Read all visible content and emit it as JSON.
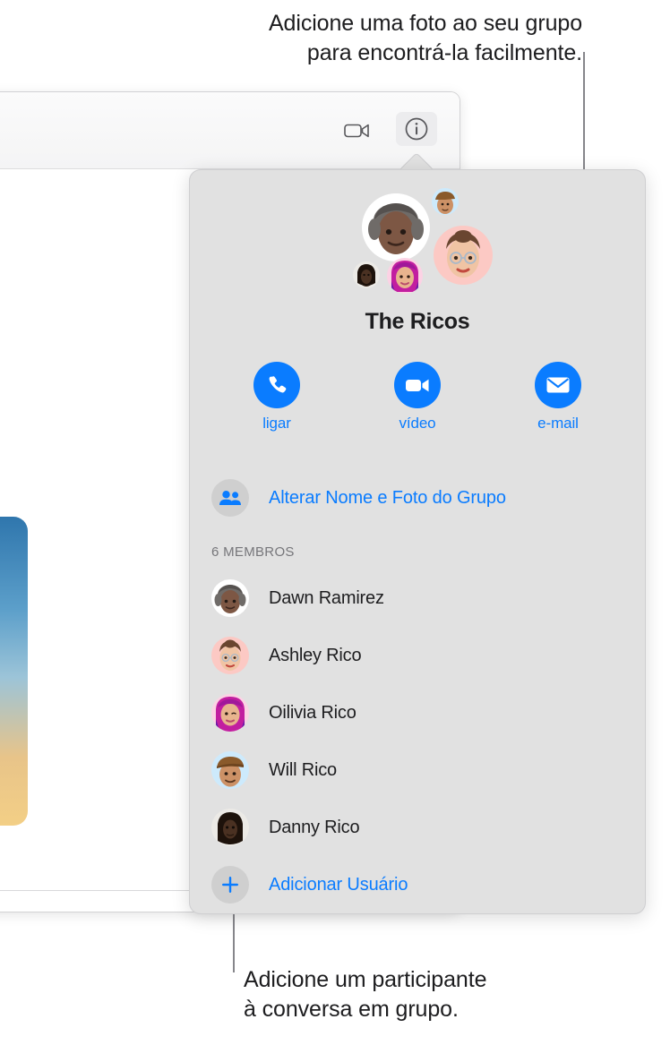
{
  "callouts": {
    "top": "Adicione uma foto ao seu grupo\npara encontrá-la facilmente.",
    "bottom": "Adicione um participante\nà conversa em grupo."
  },
  "window": {
    "toolbar": {
      "video_icon": "video-camera-icon",
      "info_icon": "info-circle-icon"
    },
    "conversation": {
      "photo_attachment": "sunset-portrait-photo"
    }
  },
  "popover": {
    "group_title": "The Ricos",
    "avatar_cluster": [
      {
        "name": "dawn-avatar",
        "bg": "#ffffff"
      },
      {
        "name": "will-avatar",
        "bg": "#cdeafc"
      },
      {
        "name": "ashley-avatar",
        "bg": "#fcc9c4"
      },
      {
        "name": "danny-avatar",
        "bg": "#eceae6"
      },
      {
        "name": "oilivia-avatar",
        "bg": "#fcd2e4"
      }
    ],
    "actions": [
      {
        "label": "ligar",
        "icon": "phone-icon"
      },
      {
        "label": "vídeo",
        "icon": "video-camera-icon"
      },
      {
        "label": "e-mail",
        "icon": "envelope-icon"
      }
    ],
    "change_group": {
      "label": "Alterar Nome e Foto do Grupo",
      "icon": "two-people-icon"
    },
    "members_header": "6 MEMBROS",
    "members": [
      {
        "name": "Dawn Ramirez",
        "avatar_bg": "#ffffff"
      },
      {
        "name": "Ashley Rico",
        "avatar_bg": "#fcc9c4"
      },
      {
        "name": "Oilivia Rico",
        "avatar_bg": "#fcd2e4"
      },
      {
        "name": "Will Rico",
        "avatar_bg": "#cdeafc"
      },
      {
        "name": "Danny Rico",
        "avatar_bg": "#eceae6"
      }
    ],
    "add_user": {
      "label": "Adicionar Usuário",
      "icon": "plus-icon"
    }
  },
  "colors": {
    "accent_blue": "#0a7cff",
    "popover_bg": "#e1e1e1",
    "text_primary": "#1d1d1f",
    "text_secondary": "#76767a",
    "leader_line": "#86868b"
  }
}
